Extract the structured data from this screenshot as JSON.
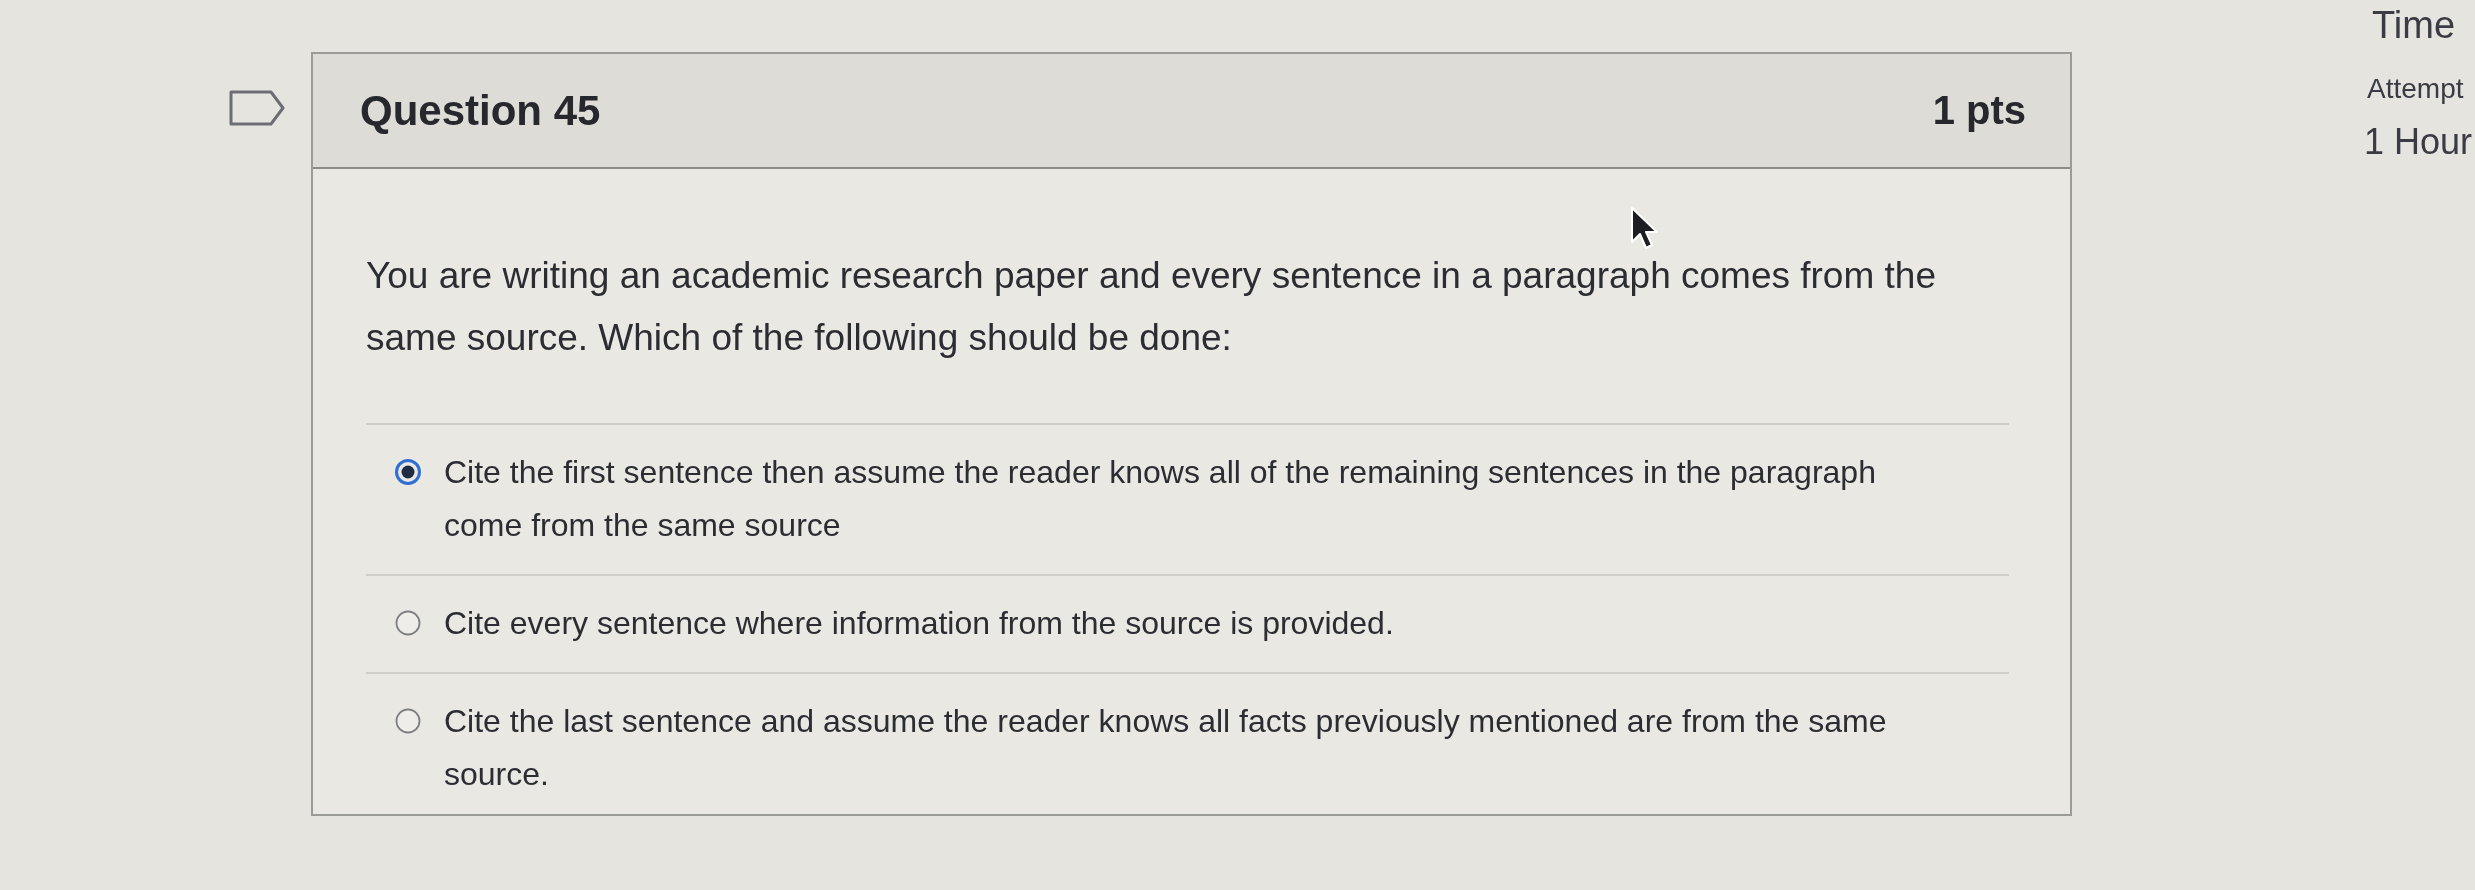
{
  "question": {
    "flagged": false,
    "title": "Question 45",
    "points": "1 pts",
    "prompt": "You are writing an academic research paper and every sentence in a paragraph comes from the same source. Which of the following should be done:",
    "answers": [
      {
        "text": "Cite the first sentence then assume the reader knows all of the remaining sentences in the paragraph come from the same source",
        "selected": true
      },
      {
        "text": "Cite every sentence where information from the source is provided.",
        "selected": false
      },
      {
        "text": "Cite the last sentence and assume the reader knows all facts previously mentioned are from the same source.",
        "selected": false
      }
    ]
  },
  "quiz_sidebar": {
    "timer_label": "Time",
    "attempt_label": "Attempt",
    "time_value": "1 Hour"
  }
}
